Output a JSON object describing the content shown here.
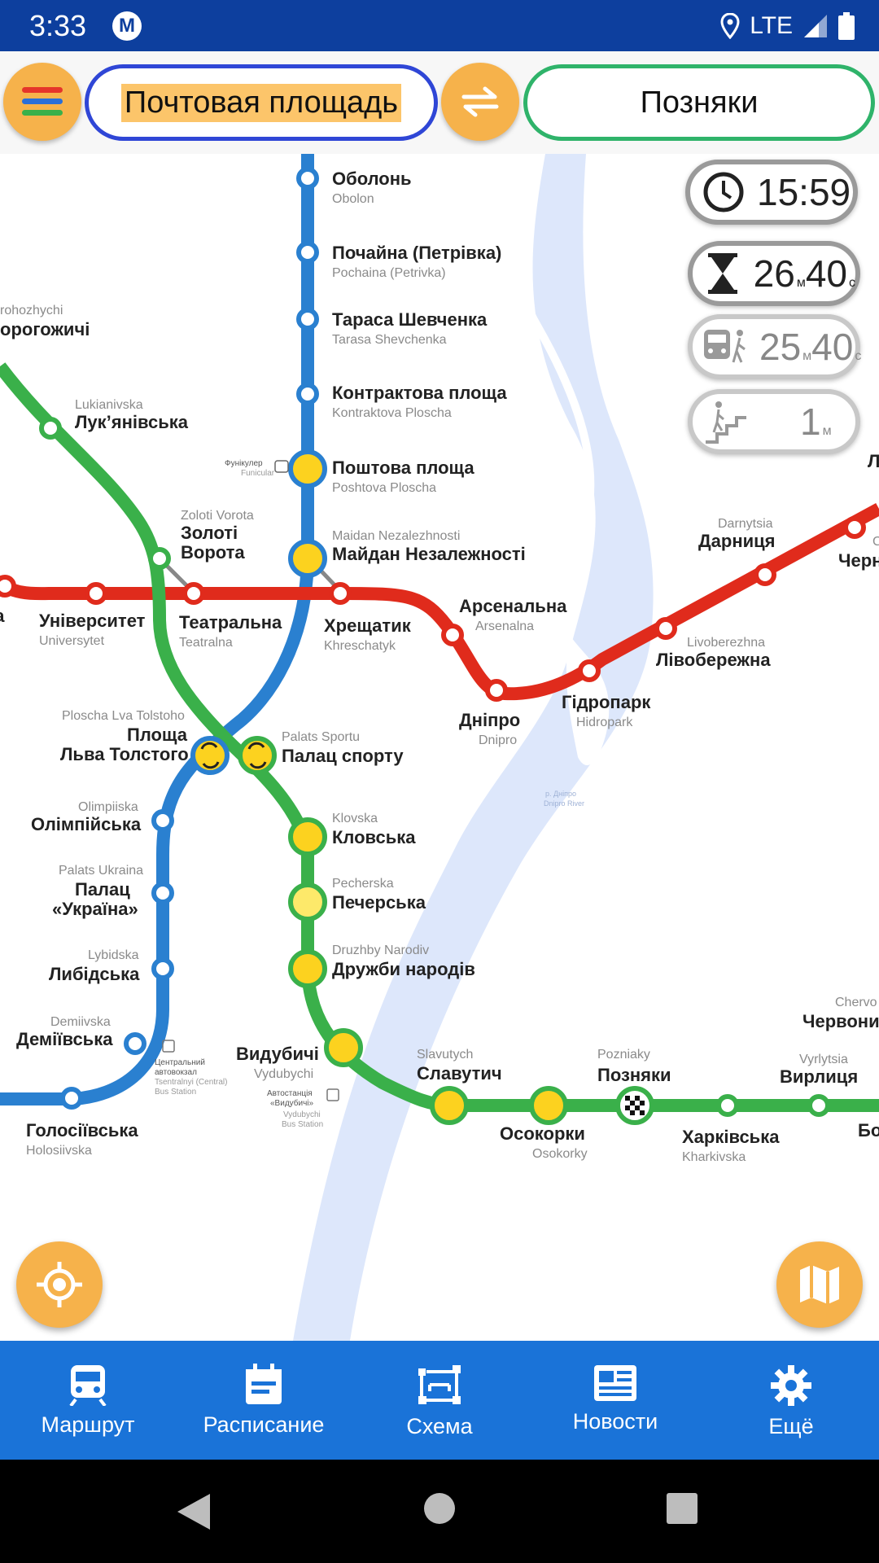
{
  "status_bar": {
    "time": "3:33",
    "network": "LTE",
    "logo_letter": "M"
  },
  "route": {
    "from": "Почтовая площадь",
    "to": "Позняки"
  },
  "info": {
    "arrival_time": "15:59",
    "total": {
      "min": "26",
      "min_unit": "м",
      "sec": "40",
      "sec_unit": "с"
    },
    "ride": {
      "min": "25",
      "min_unit": "м",
      "sec": "40",
      "sec_unit": "с"
    },
    "walk": {
      "min": "1",
      "min_unit": "м"
    }
  },
  "map": {
    "river_label": "р. Дніпро",
    "river_label_en": "Dnipro River",
    "funicular": {
      "ua": "Фунікулер",
      "en": "Funicular"
    },
    "bus_central": {
      "ua1": "Центральний",
      "ua2": "автовокзал",
      "en1": "Tsentralnyi (Central)",
      "en2": "Bus Station"
    },
    "bus_vydubychi": {
      "ua1": "Автостанція",
      "ua2": "«Видубичі»",
      "en1": "Vydubychi",
      "en2": "Bus Station"
    },
    "stations": [
      {
        "id": "obolon",
        "ua": "Оболонь",
        "en": "Obolon"
      },
      {
        "id": "pochaina",
        "ua": "Почайна (Петрівка)",
        "en": "Pochaina (Petrivka)"
      },
      {
        "id": "tarasa",
        "ua": "Тараса Шевченка",
        "en": "Tarasa Shevchenka"
      },
      {
        "id": "kontraktova",
        "ua": "Контрактова площа",
        "en": "Kontraktova Ploscha"
      },
      {
        "id": "poshtova",
        "ua": "Поштова площа",
        "en": "Poshtova Ploscha"
      },
      {
        "id": "maidan",
        "ua": "Майдан Незалежності",
        "en": "Maidan Nezalezhnosti"
      },
      {
        "id": "dorohozhychi",
        "ua": "орогожичі",
        "en": "rohozhychi"
      },
      {
        "id": "lukianivska",
        "ua": "Лук’янівська",
        "en": "Lukianivska"
      },
      {
        "id": "zoloti",
        "ua1": "Золоті",
        "ua2": "Ворота",
        "en": "Zoloti Vorota"
      },
      {
        "id": "universytet",
        "ua": "Університет",
        "en": "Universytet"
      },
      {
        "id": "teatralna",
        "ua": "Театральна",
        "en": "Teatralna"
      },
      {
        "id": "khreschatyk",
        "ua": "Хрещатик",
        "en": "Khreschatyk"
      },
      {
        "id": "arsenalna",
        "ua": "Арсенальна",
        "en": "Arsenalna"
      },
      {
        "id": "dnipro",
        "ua": "Дніпро",
        "en": "Dnipro"
      },
      {
        "id": "hidropark",
        "ua": "Гідропарк",
        "en": "Hidropark"
      },
      {
        "id": "livoberezhna",
        "ua": "Лівобережна",
        "en": "Livoberezhna"
      },
      {
        "id": "darnytsia",
        "ua": "Дарниця",
        "en": "Darnytsia"
      },
      {
        "id": "cherni",
        "ua": "Черн",
        "en": "C"
      },
      {
        "id": "tolstoho",
        "ua1": "Площа",
        "ua2": "Льва Толстого",
        "en": "Ploscha Lva Tolstoho"
      },
      {
        "id": "palats_sportu",
        "ua": "Палац спорту",
        "en": "Palats Sportu"
      },
      {
        "id": "olimpiiska",
        "ua": "Олімпійська",
        "en": "Olimpiiska"
      },
      {
        "id": "palats_ukraina",
        "ua1": "Палац",
        "ua2": "«Україна»",
        "en": "Palats Ukraina"
      },
      {
        "id": "lybidska",
        "ua": "Либідська",
        "en": "Lybidska"
      },
      {
        "id": "demiivska",
        "ua": "Деміївська",
        "en": "Demiivska"
      },
      {
        "id": "holosiivska",
        "ua": "Голосіївська",
        "en": "Holosiivska"
      },
      {
        "id": "klovska",
        "ua": "Кловська",
        "en": "Klovska"
      },
      {
        "id": "pecherska",
        "ua": "Печерська",
        "en": "Pecherska"
      },
      {
        "id": "druzhby",
        "ua": "Дружби народів",
        "en": "Druzhby Narodiv"
      },
      {
        "id": "vydubychi",
        "ua": "Видубичі",
        "en": "Vydubychi"
      },
      {
        "id": "slavutych",
        "ua": "Славутич",
        "en": "Slavutych"
      },
      {
        "id": "osokorky",
        "ua": "Осокорки",
        "en": "Osokorky"
      },
      {
        "id": "pozniaky",
        "ua": "Позняки",
        "en": "Pozniaky"
      },
      {
        "id": "kharkivska",
        "ua": "Харківська",
        "en": "Kharkivska"
      },
      {
        "id": "vyrlytsia",
        "ua": "Вирлиця",
        "en": "Vyrlytsia"
      },
      {
        "id": "chervonyi",
        "ua": "Червони",
        "en": "Chervo"
      },
      {
        "id": "bo",
        "ua": "Бо",
        "en": ""
      }
    ]
  },
  "bottom_nav": [
    {
      "label": "Маршрут",
      "icon": "train-icon"
    },
    {
      "label": "Расписание",
      "icon": "calendar-icon"
    },
    {
      "label": "Схема",
      "icon": "scheme-icon"
    },
    {
      "label": "Новости",
      "icon": "news-icon"
    },
    {
      "label": "Ещё",
      "icon": "gear-icon"
    }
  ],
  "colors": {
    "red_line": "#e02b1c",
    "blue_line": "#2a80d0",
    "green_line": "#3ab04a",
    "route_station": "#fcd21f",
    "accent_orange": "#f6b24b",
    "nav_blue": "#1a73d8",
    "status_blue": "#0d3f9e",
    "river": "#dde7fb"
  }
}
